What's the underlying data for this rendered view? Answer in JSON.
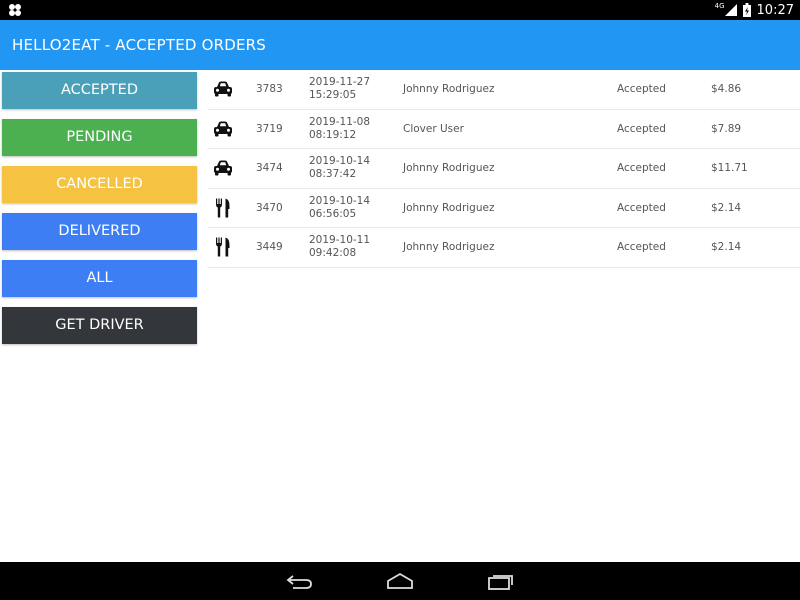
{
  "status_bar": {
    "network_label": "4G",
    "time": "10:27",
    "icons": [
      "app-notification-icon",
      "signal-icon",
      "battery-charging-icon"
    ]
  },
  "app_bar": {
    "title": "HELLO2EAT - ACCEPTED ORDERS"
  },
  "sidebar": {
    "buttons": [
      {
        "label": "ACCEPTED",
        "color": "#4a9fb9"
      },
      {
        "label": "PENDING",
        "color": "#4caf50"
      },
      {
        "label": "CANCELLED",
        "color": "#f5c242"
      },
      {
        "label": "DELIVERED",
        "color": "#3d7ef5"
      },
      {
        "label": "ALL",
        "color": "#3d7ef5"
      },
      {
        "label": "GET DRIVER",
        "color": "#33373b"
      }
    ]
  },
  "orders": [
    {
      "type_icon": "car-icon",
      "id": "3783",
      "date": "2019-11-27",
      "time": "15:29:05",
      "customer": "Johnny Rodriguez",
      "status": "Accepted",
      "amount": "$4.86"
    },
    {
      "type_icon": "car-icon",
      "id": "3719",
      "date": "2019-11-08",
      "time": "08:19:12",
      "customer": "Clover User",
      "status": "Accepted",
      "amount": "$7.89"
    },
    {
      "type_icon": "car-icon",
      "id": "3474",
      "date": "2019-10-14",
      "time": "08:37:42",
      "customer": "Johnny Rodriguez",
      "status": "Accepted",
      "amount": "$11.71"
    },
    {
      "type_icon": "fork-knife-icon",
      "id": "3470",
      "date": "2019-10-14",
      "time": "06:56:05",
      "customer": "Johnny Rodriguez",
      "status": "Accepted",
      "amount": "$2.14"
    },
    {
      "type_icon": "fork-knife-icon",
      "id": "3449",
      "date": "2019-10-11",
      "time": "09:42:08",
      "customer": "Johnny Rodriguez",
      "status": "Accepted",
      "amount": "$2.14"
    }
  ],
  "nav_bar": {
    "buttons": [
      "back-icon",
      "home-icon",
      "recent-apps-icon"
    ]
  },
  "colors": {
    "app_bar": "#2196f3",
    "status_bar": "#000000",
    "text": "#555555"
  }
}
